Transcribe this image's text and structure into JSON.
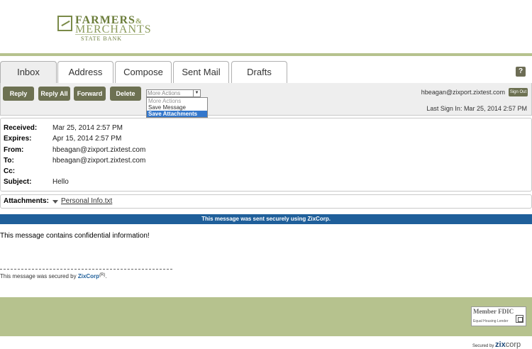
{
  "logo": {
    "line1": "FARMERS",
    "amp": "&",
    "line2": "MERCHANTS",
    "line3": "STATE BANK"
  },
  "tabs": [
    {
      "label": "Inbox",
      "active": true
    },
    {
      "label": "Address"
    },
    {
      "label": "Compose"
    },
    {
      "label": "Sent Mail"
    },
    {
      "label": "Drafts"
    }
  ],
  "help_label": "?",
  "toolbar": {
    "reply": "Reply",
    "reply_all": "Reply All",
    "forward": "Forward",
    "delete": "Delete",
    "more_actions_value": "More Actions",
    "more_actions_options": [
      "More Actions",
      "Save Message",
      "Save Attachments"
    ],
    "user_email": "hbeagan@zixport.zixtest.com",
    "sign_out": "Sign Out",
    "last_sign_in": "Last Sign In: Mar 25, 2014 2:57 PM"
  },
  "message": {
    "received_label": "Received:",
    "received": "Mar 25, 2014 2:57 PM",
    "expires_label": "Expires:",
    "expires": "Apr 15, 2014 2:57 PM",
    "from_label": "From:",
    "from": "hbeagan@zixport.zixtest.com",
    "to_label": "To:",
    "to": "hbeagan@zixport.zixtest.com",
    "cc_label": "Cc:",
    "cc": "",
    "subject_label": "Subject:",
    "subject": "Hello"
  },
  "attachments": {
    "label": "Attachments:",
    "file": "Personal Info.txt"
  },
  "secure_banner": "This message was sent securely using ZixCorp.",
  "body_text": "This message contains confidential information!",
  "footer_note": {
    "prefix": "This message was secured by ",
    "brand": "ZixCorp",
    "reg": "(R)",
    "suffix": "."
  },
  "fdic": {
    "line1": "Member FDIC",
    "line2": "Equal Housing Lender"
  },
  "secured_by": {
    "prefix": "Secured by ",
    "brand": "zix",
    "brand_suffix": "corp"
  },
  "colors": {
    "brand_green": "#b6c28e",
    "button": "#6d7152",
    "banner_blue": "#1f5f9a"
  }
}
